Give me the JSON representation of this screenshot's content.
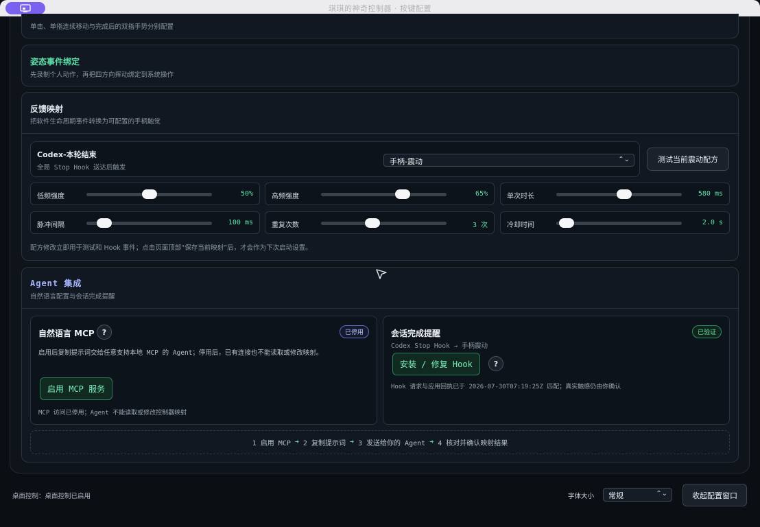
{
  "window": {
    "title": "琪琪的神奇控制器 · 按键配置"
  },
  "tap_card": {
    "subtitle": "单击、单指连续移动与完成后的双指手势分别配置"
  },
  "gesture_card": {
    "title": "姿态事件绑定",
    "subtitle": "先录制个人动作，再把四方向挥动绑定到系统操作"
  },
  "feedback_card": {
    "title": "反馈映射",
    "subtitle": "把软件生命周期事件转换为可配置的手柄触觉",
    "event": {
      "title": "Codex-本轮结束",
      "subtitle": "全局 Stop Hook 送达后触发",
      "selected_action": "手柄-震动"
    },
    "test_button": "测试当前震动配方",
    "sliders": [
      {
        "label": "低频强度",
        "value_text": "50%",
        "fraction": 0.5
      },
      {
        "label": "高频强度",
        "value_text": "65%",
        "fraction": 0.65
      },
      {
        "label": "单次时长",
        "value_text": "580 ms",
        "fraction": 0.54
      },
      {
        "label": "脉冲间隔",
        "value_text": "100 ms",
        "fraction": 0.14
      },
      {
        "label": "重复次数",
        "value_text": "3 次",
        "fraction": 0.41
      },
      {
        "label": "冷却时间",
        "value_text": "2.0 s",
        "fraction": 0.08
      }
    ],
    "note": "配方修改立即用于测试和 Hook 事件；点击页面顶部“保存当前映射”后，才会作为下次启动设置。"
  },
  "agent_card": {
    "title": "Agent 集成",
    "subtitle": "自然语言配置与会话完成提醒",
    "mcp": {
      "title": "自然语言 MCP",
      "badge": "已停用",
      "description": "启用后复制提示词交给任意支持本地 MCP 的 Agent；停用后，已有连接也不能读取或修改映射。",
      "button": "启用 MCP 服务",
      "footer": "MCP 访问已停用；Agent 不能读取或修改控制器映射"
    },
    "session": {
      "title": "会话完成提醒",
      "badge": "已验证",
      "subtitle": "Codex Stop Hook → 手柄震动",
      "button": "安装 / 修复 Hook",
      "footer": "Hook 请求与应用回执已于 2026-07-30T07:19:25Z 匹配；真实触感仍由你确认"
    },
    "help_glyph": "?",
    "steps": [
      "1 启用 MCP",
      "2 复制提示词",
      "3 发送给你的 Agent",
      "4 核对并确认映射结果"
    ]
  },
  "footer": {
    "status": "桌面控制：桌面控制已启用",
    "font_size_label": "字体大小",
    "font_size_value": "常规",
    "collapse_button": "收起配置窗口"
  },
  "colors": {
    "accent_green": "#5fe0a9",
    "accent_purple": "#7b61f0",
    "agent_title": "#a7b6ff"
  }
}
